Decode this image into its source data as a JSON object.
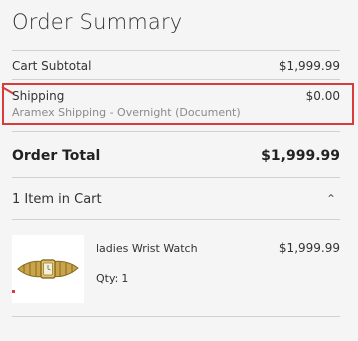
{
  "summary": {
    "title": "Order Summary",
    "cart_subtotal_label": "Cart Subtotal",
    "cart_subtotal_value": "$1,999.99",
    "shipping_label": "Shipping",
    "shipping_value": "$0.00",
    "shipping_method": "Aramex Shipping - Overnight (Document)",
    "order_total_label": "Order Total",
    "order_total_value": "$1,999.99"
  },
  "cart": {
    "items_label": "1 Item in Cart",
    "toggle_icon": "chevron-up-icon",
    "items": [
      {
        "name": "ladies Wrist Watch",
        "price": "$1,999.99",
        "qty_label": "Qty:",
        "qty_value": "1"
      }
    ]
  },
  "colors": {
    "highlight": "#d83b3b",
    "background": "#f5f5f5",
    "divider": "#d1d1d1"
  }
}
